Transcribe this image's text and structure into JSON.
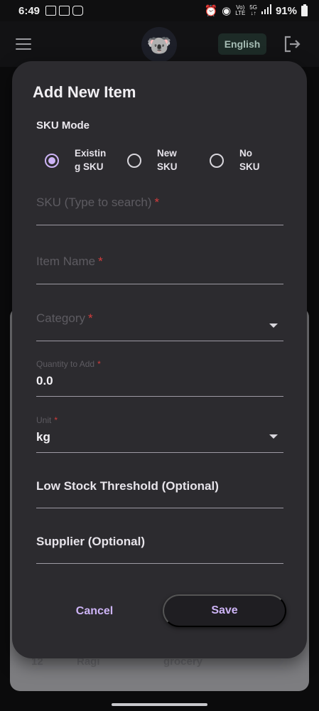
{
  "status_bar": {
    "time": "6:49",
    "network_small_top": "Vo)",
    "network_small_bottom": "LTE",
    "gen_top": "5G",
    "gen_bottom": "↓↑",
    "battery": "91%"
  },
  "app_bar": {
    "language": "English",
    "avatar_emoji": "🐨"
  },
  "background_list": {
    "row": [
      "12",
      "Ragi",
      "grocery"
    ]
  },
  "dialog": {
    "title": "Add New Item",
    "sku_mode_label": "SKU Mode",
    "sku_modes": [
      {
        "line1": "Existin",
        "line2": "g SKU",
        "selected": true
      },
      {
        "line1": "New",
        "line2": "SKU",
        "selected": false
      },
      {
        "line1": "No",
        "line2": "SKU",
        "selected": false
      }
    ],
    "fields": {
      "sku": {
        "placeholder": "SKU (Type to search)",
        "required": "*"
      },
      "item_name": {
        "placeholder": "Item Name",
        "required": "*"
      },
      "category": {
        "placeholder": "Category",
        "required": "*"
      },
      "quantity": {
        "label": "Quantity to Add",
        "required": "*",
        "value": "0.0"
      },
      "unit": {
        "label": "Unit",
        "required": "*",
        "value": "kg"
      },
      "low_stock": {
        "label": "Low Stock Threshold (Optional)"
      },
      "supplier": {
        "label": "Supplier (Optional)"
      }
    },
    "cancel_label": "Cancel",
    "save_label": "Save"
  },
  "colors": {
    "accent": "#cdb4f6",
    "required": "#d43d3d",
    "dialog_bg": "#2c2b2f"
  }
}
